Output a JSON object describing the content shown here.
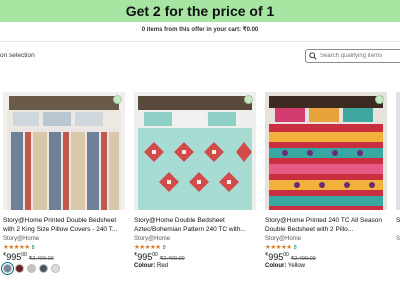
{
  "banner": {
    "title": "Get 2 for the price of 1"
  },
  "cart": {
    "count_text": "0 items from this offer in your cart:",
    "total": "₹0.00"
  },
  "selection": {
    "label": "on selection"
  },
  "search": {
    "placeholder": "Search qualifying items"
  },
  "products": [
    {
      "title": "Story@Home Printed Double Bedsheet with 2 King Size Pillow Covers - 240 T...",
      "brand": "Story@Home",
      "stars": "★★★★★",
      "rating_count": "8",
      "price": "995",
      "price_cents": "00",
      "mrp": "₹2,499.00",
      "swatches": [
        "#7a8597",
        "#6b1f1f",
        "#c2c2c2",
        "#4a5560",
        "#dcdcdc"
      ]
    },
    {
      "title": "Story@Home Double Bedsheet Aztec/Bohemian Pattern 240 TC with...",
      "brand": "Story@Home",
      "stars": "★★★★★",
      "rating_count": "8",
      "price": "995",
      "price_cents": "00",
      "mrp": "₹2,499.00",
      "colour_label": "Colour:",
      "colour_value": "Red"
    },
    {
      "title": "Story@Home Printed 240 TC All Season Double Bedsheet with 2 Pillo...",
      "brand": "Story@Home",
      "stars": "★★★★★",
      "rating_count": "8",
      "price": "995",
      "price_cents": "00",
      "mrp": "₹2,499.00",
      "colour_label": "Colour:",
      "colour_value": "Yellow"
    },
    {
      "title": "S",
      "brand": "S"
    }
  ],
  "currency": "₹"
}
